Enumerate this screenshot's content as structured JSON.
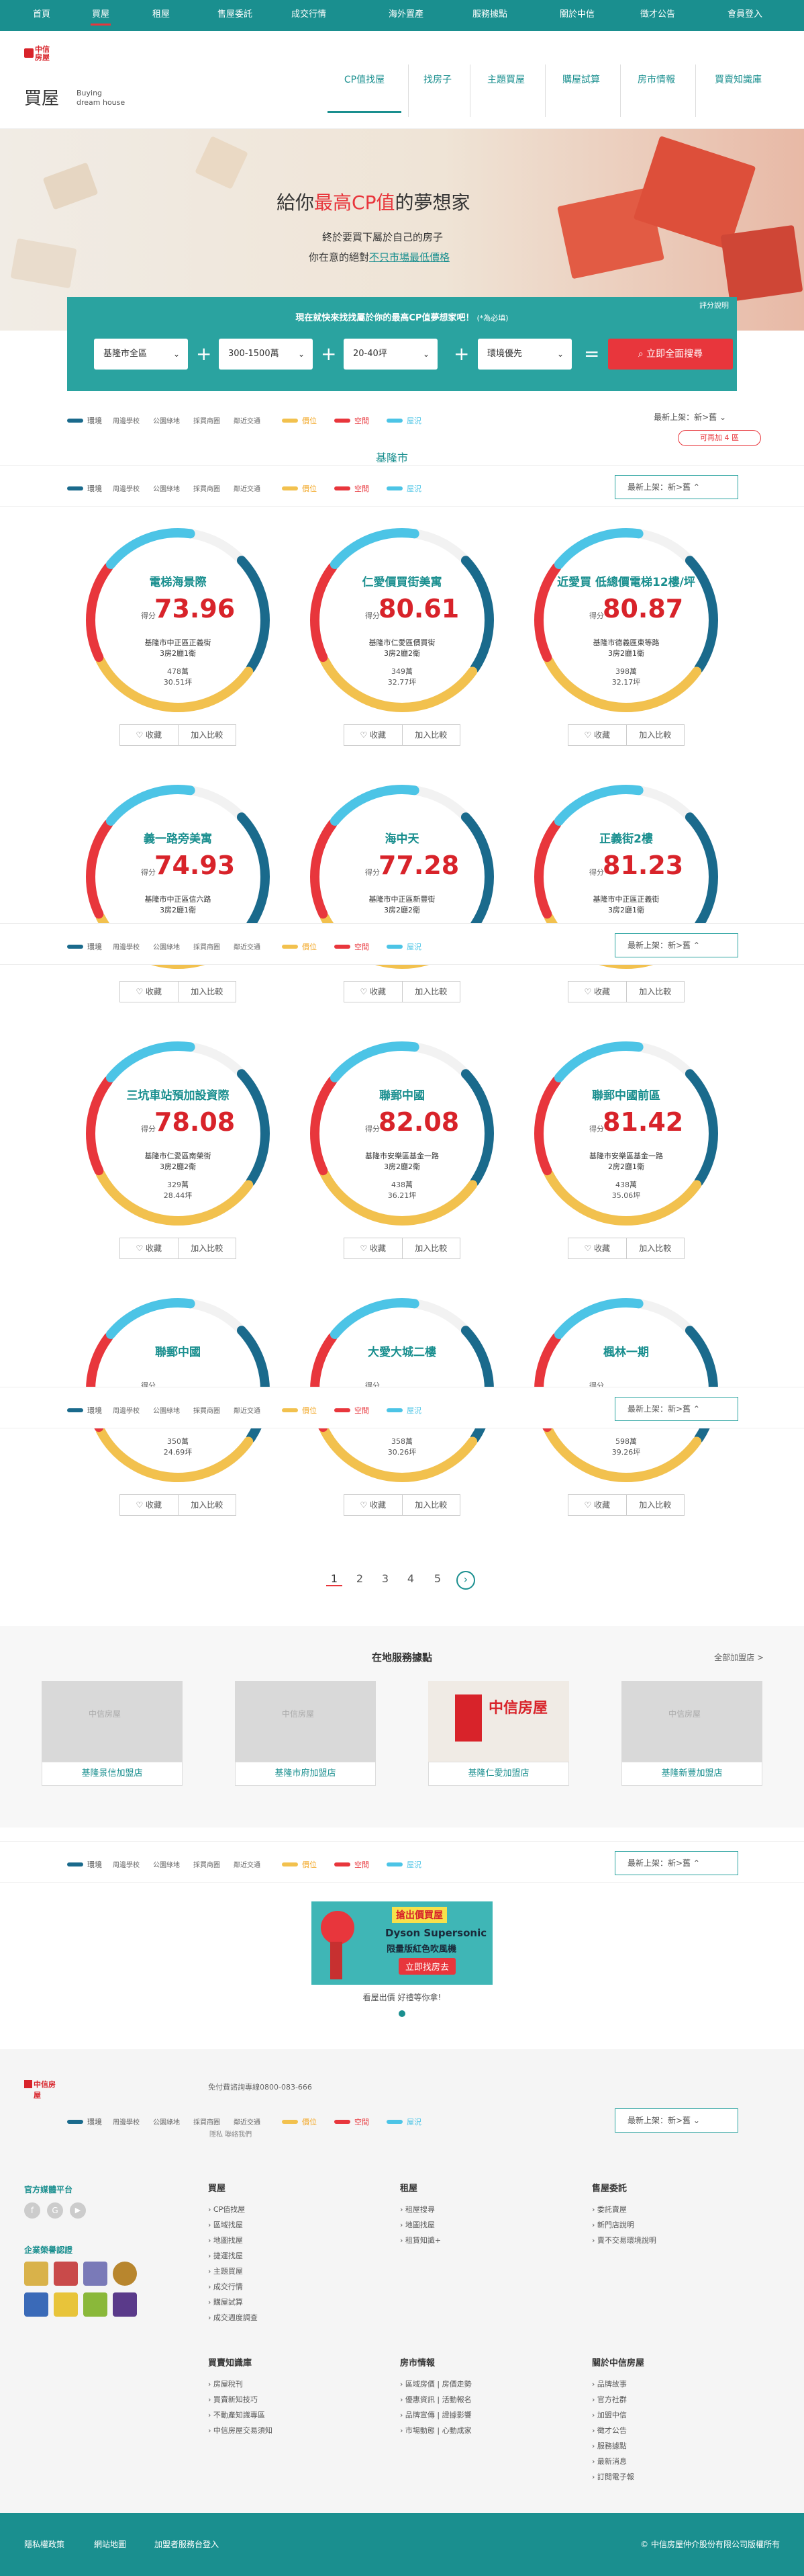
{
  "topnav": {
    "items": [
      "首頁",
      "買屋",
      "租屋",
      "售屋委託",
      "成交行情",
      "海外置產",
      "服務據點",
      "關於中信",
      "徵才公告",
      "會員登入"
    ]
  },
  "header": {
    "title_cn": "買屋",
    "title_en_1": "Buying",
    "title_en_2": "dream house",
    "logo_text": "中信房屋",
    "subnav": [
      "CP值找屋",
      "找房子",
      "主題買屋",
      "購屋試算",
      "房市情報",
      "買賣知識庫"
    ]
  },
  "hero": {
    "headline_a": "給你",
    "headline_b": "最高CP值",
    "headline_c": "的夢想家",
    "line1": "終於要買下屬於自己的房子",
    "line2a": "你在意的絕對",
    "line2b": "不只市場最低價格"
  },
  "search": {
    "title": "現在就快來找找屬於你的最高CP值夢想家吧！",
    "note": "(*為必填)",
    "help": "評分說明",
    "city": "基隆市全區",
    "price": "300-1500萬",
    "size": "20-40坪",
    "pref": "環境優先",
    "button": "立即全面搜尋",
    "tag": "可再加 4 區"
  },
  "legend": {
    "items": [
      {
        "label": "環境",
        "color": "#1a6a8c"
      },
      {
        "label": "周邊學校",
        "color": ""
      },
      {
        "label": "公園綠地",
        "color": ""
      },
      {
        "label": "採買商圈",
        "color": ""
      },
      {
        "label": "鄰近交通",
        "color": ""
      },
      {
        "label": "價位",
        "color": "#f2c14e"
      },
      {
        "label": "空間",
        "color": "#e8363c"
      },
      {
        "label": "屋況",
        "color": "#4cc4e6"
      }
    ],
    "sort": "最新上架：新>舊",
    "peek": "基隆市"
  },
  "cards": [
    {
      "name": "電梯海景際",
      "score": "73.96",
      "addr": "基隆市中正區正義街",
      "layout": "3房2廳1衛",
      "price": "478萬",
      "area": "30.51坪"
    },
    {
      "name": "仁愛價買街美寓",
      "score": "80.61",
      "addr": "基隆市仁愛區價買街",
      "layout": "3房2廳2衛",
      "price": "349萬",
      "area": "32.77坪"
    },
    {
      "name": "近愛買 低總價電梯12樓/坪",
      "score": "80.87",
      "addr": "基隆市德義區東等路",
      "layout": "3房2廳1衛",
      "price": "398萬",
      "area": "32.17坪"
    },
    {
      "name": "義一路旁美寓",
      "score": "74.93",
      "addr": "基隆市中正區信六路",
      "layout": "3房2廳1衛",
      "price": "",
      "area": ""
    },
    {
      "name": "海中天",
      "score": "77.28",
      "addr": "基隆市中正區新豐街",
      "layout": "3房2廳2衛",
      "price": "",
      "area": ""
    },
    {
      "name": "正義街2樓",
      "score": "81.23",
      "addr": "基隆市中正區正義街",
      "layout": "3房2廳1衛",
      "price": "",
      "area": ""
    },
    {
      "name": "三坑車站預加設資際",
      "score": "78.08",
      "addr": "基隆市仁愛區南榮街",
      "layout": "3房2廳2衛",
      "price": "329萬",
      "area": "28.44坪"
    },
    {
      "name": "聯郵中國",
      "score": "82.08",
      "addr": "基隆市安樂區基金一路",
      "layout": "3房2廳2衛",
      "price": "438萬",
      "area": "36.21坪"
    },
    {
      "name": "聯郵中國前區",
      "score": "81.42",
      "addr": "基隆市安樂區基金一路",
      "layout": "2房2廳1衛",
      "price": "438萬",
      "area": "35.06坪"
    },
    {
      "name": "聯郵中國",
      "score": "",
      "addr": "",
      "layout": "2房1廳1衛",
      "price": "350萬",
      "area": "24.69坪"
    },
    {
      "name": "大愛大城二樓",
      "score": "",
      "addr": "",
      "layout": "3房2廳2衛",
      "price": "358萬",
      "area": "30.26坪"
    },
    {
      "name": "楓林一期",
      "score": "",
      "addr": "",
      "layout": "3房2廳1衛",
      "price": "598萬",
      "area": "39.26坪"
    }
  ],
  "card_buttons": {
    "save": "收藏",
    "compare": "加入比較"
  },
  "pager": {
    "pages": [
      "1",
      "2",
      "3",
      "4",
      "5"
    ],
    "next": "›"
  },
  "shops": {
    "title": "在地服務據點",
    "more": "全部加盟店 >",
    "items": [
      "基隆景信加盟店",
      "基隆市府加盟店",
      "基隆仁愛加盟店",
      "基隆新豐加盟店"
    ],
    "logo_text": "中信房屋"
  },
  "ad": {
    "badge": "搶出價買屋",
    "product": "Dyson Supersonic",
    "sub": "限量版紅色吹風機",
    "cta": "立即找房去",
    "caption": "看屋出價 好禮等你拿!"
  },
  "footer": {
    "hotline": "免付費諮詢專線0800-083-666",
    "links_small": [
      "隱私",
      "聯絡我們"
    ],
    "social_title": "官方媒體平台",
    "cert_title": "企業榮譽認證",
    "cols": [
      {
        "h": "買屋",
        "items": [
          "CP值找屋",
          "區域找屋",
          "地圖找屋",
          "捷運找屋",
          "主題買屋",
          "成交行情",
          "購屋試算",
          "成交週度調查"
        ]
      },
      {
        "h": "租屋",
        "items": [
          "租屋搜尋",
          "地圖找屋",
          "租賃知識+"
        ]
      },
      {
        "h": "售屋委託",
        "items": [
          "委託賣屋",
          "新門店說明",
          "賣不交易環境說明"
        ]
      },
      {
        "h": "買賣知識庫",
        "items": [
          "房屋稅刊",
          "買賣新知技巧",
          "不動產知識專區",
          "中信房屋交易須知"
        ]
      },
      {
        "h": "房市情報",
        "items": [
          "區域房價 | 房價走勢",
          "優惠資訊 | 活動報名",
          "品牌宣傳 | 證據影響",
          "市場動態 | 心動成家"
        ]
      },
      {
        "h": "關於中信房屋",
        "items": [
          "品牌故事",
          "官方社群",
          "加盟中信",
          "徵才公告",
          "服務據點",
          "最新消息",
          "訂閱電子報"
        ]
      }
    ]
  },
  "bottom": {
    "links": [
      "隱私權政策",
      "網站地圖",
      "加盟者服務台登入"
    ],
    "copyright": "© 中信房屋仲介股份有限公司版權所有"
  },
  "colors": {
    "teal": "#1a8f8f",
    "red": "#d8232a",
    "ring_env": "#1a6a8c",
    "ring_price": "#f2c14e",
    "ring_space": "#e8363c",
    "ring_cond": "#4cc4e6"
  }
}
